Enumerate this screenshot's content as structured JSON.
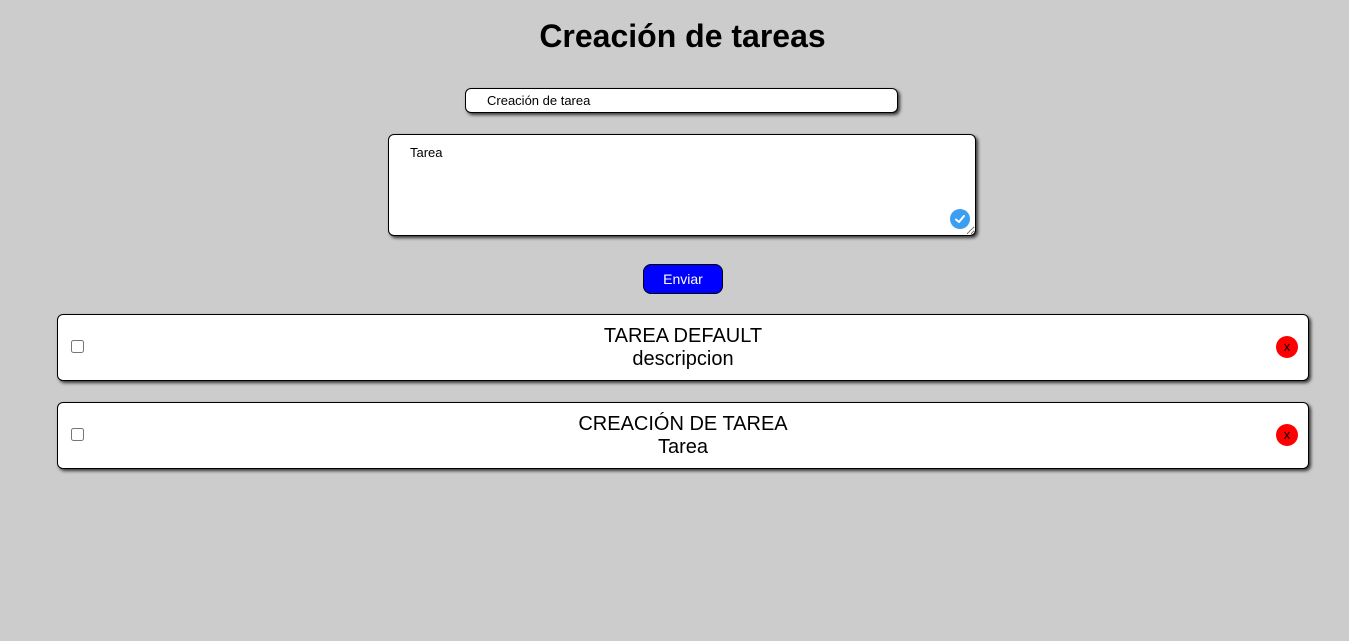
{
  "header": {
    "title": "Creación de tareas"
  },
  "form": {
    "title_value": "Creación de tarea",
    "description_value": "Tarea",
    "submit_label": "Enviar"
  },
  "tasks": [
    {
      "title": "TAREA DEFAULT",
      "description": "descripcion",
      "checked": false,
      "delete_label": "x"
    },
    {
      "title": "CREACIÓN DE TAREA",
      "description": "Tarea",
      "checked": false,
      "delete_label": "x"
    }
  ],
  "colors": {
    "background": "#cccccc",
    "submit_button": "#0000ff",
    "delete_button": "#ff0000",
    "badge": "#3b9ef0"
  },
  "icons": {
    "textarea_badge": "checkmark-circle-icon"
  }
}
